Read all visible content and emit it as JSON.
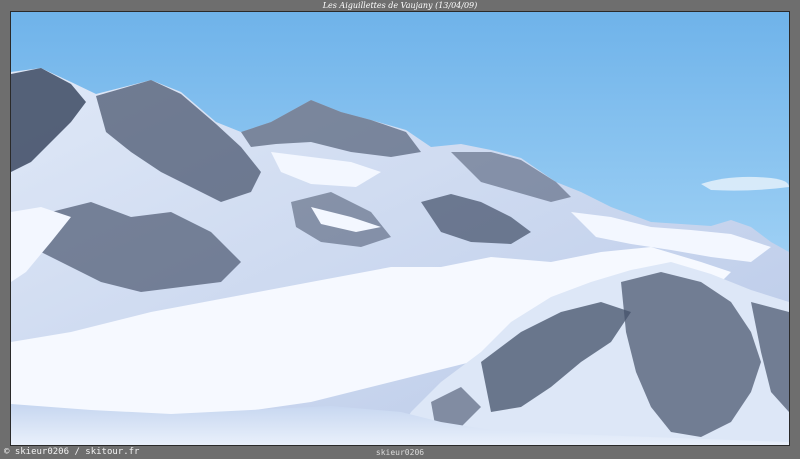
{
  "caption": "Les Aiguillettes de Vaujany (13/04/09)",
  "credit": "© skieur0206 / skitour.fr",
  "watermark": "skieur0206",
  "colors": {
    "frame": "#6e6e6e",
    "sky_top": "#78b9ec",
    "sky_bottom": "#bfe0f6",
    "snow": "#f4f8ff",
    "rock": "#3c4860"
  }
}
